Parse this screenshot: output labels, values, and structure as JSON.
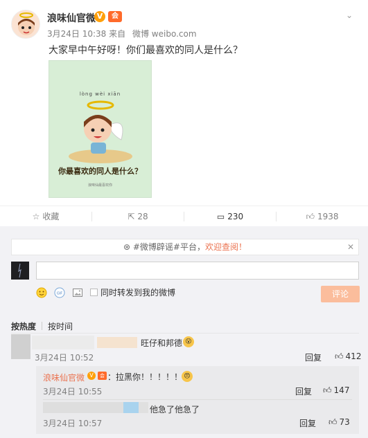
{
  "post": {
    "author": "浪味仙官微",
    "verified_mark": "V",
    "vip_mark": "会",
    "date": "3月24日 10:38",
    "source_prefix": "来自",
    "source": "微博 weibo.com",
    "text": "大家早中午好呀！你们最喜欢的同人是什么？",
    "image": {
      "top_text": "lòng wèi xiān",
      "caption": "你最喜欢的同人是什么？",
      "small_text": "浪味仙最喜欢你"
    }
  },
  "actions": {
    "favorite": "收藏",
    "repost_count": "28",
    "comment_count": "230",
    "like_count": "1938"
  },
  "comments_area": {
    "notice_tag": "#微博辟谣#平台，",
    "notice_link": "欢迎查阅！",
    "notice_close": "✕",
    "input_value": "",
    "repost_option": "同时转发到我的微博",
    "submit": "评论",
    "sort_hot": "按热度",
    "sort_time": "按时间"
  },
  "comments": [
    {
      "text": "旺仔和邦德",
      "time": "3月24日 10:52",
      "reply": "回复",
      "likes": "412",
      "replies": [
        {
          "author": "浪味仙官微",
          "text": "：拉黑你！！！！！",
          "time": "3月24日 10:55",
          "reply": "回复",
          "likes": "147"
        },
        {
          "text": "他急了他急了",
          "time": "3月24日 10:57",
          "reply": "回复",
          "likes": "73"
        }
      ]
    }
  ],
  "colors": {
    "accent": "#eb7350",
    "submit_disabled": "#fbbd9c",
    "comment_bg": "#f2f2f5",
    "image_bg": "#d8eed6"
  },
  "icons": [
    "star-icon",
    "repost-icon",
    "comment-icon",
    "like-icon",
    "emoji-icon",
    "gif-icon",
    "image-icon",
    "chevron-down-icon",
    "close-icon"
  ]
}
